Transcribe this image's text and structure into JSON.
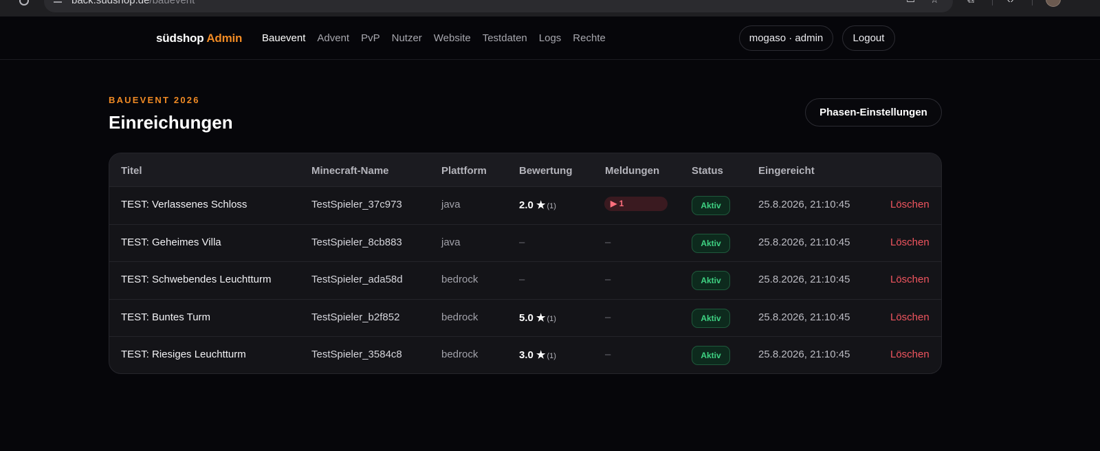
{
  "browser": {
    "url_host": "back.südshop.de",
    "url_path": "/bauevent"
  },
  "brand": {
    "name": "südshop",
    "suffix": "Admin"
  },
  "nav": {
    "items": [
      "Bauevent",
      "Advent",
      "PvP",
      "Nutzer",
      "Website",
      "Testdaten",
      "Logs",
      "Rechte"
    ],
    "active": "Bauevent"
  },
  "user": {
    "label": "mogaso · admin",
    "logout_label": "Logout"
  },
  "page": {
    "eyebrow": "BAUEVENT 2026",
    "title": "Einreichungen",
    "phase_button_label": "Phasen-Einstellungen"
  },
  "table": {
    "columns": [
      "Titel",
      "Minecraft-Name",
      "Plattform",
      "Bewertung",
      "Meldungen",
      "Status",
      "Eingereicht"
    ],
    "rows": [
      {
        "title": "TEST: Verlassenes Schloss",
        "mc_name": "TestSpieler_37c973",
        "platform": "java",
        "rating": "2.0 ★",
        "rating_count": "(1)",
        "reports": "1",
        "status": "Aktiv",
        "submitted": "25.8.2026, 21:10:45",
        "action": "Löschen"
      },
      {
        "title": "TEST: Geheimes Villa",
        "mc_name": "TestSpieler_8cb883",
        "platform": "java",
        "rating": "–",
        "rating_count": "",
        "reports": "–",
        "status": "Aktiv",
        "submitted": "25.8.2026, 21:10:45",
        "action": "Löschen"
      },
      {
        "title": "TEST: Schwebendes Leuchtturm",
        "mc_name": "TestSpieler_ada58d",
        "platform": "bedrock",
        "rating": "–",
        "rating_count": "",
        "reports": "–",
        "status": "Aktiv",
        "submitted": "25.8.2026, 21:10:45",
        "action": "Löschen"
      },
      {
        "title": "TEST: Buntes Turm",
        "mc_name": "TestSpieler_b2f852",
        "platform": "bedrock",
        "rating": "5.0 ★",
        "rating_count": "(1)",
        "reports": "–",
        "status": "Aktiv",
        "submitted": "25.8.2026, 21:10:45",
        "action": "Löschen"
      },
      {
        "title": "TEST: Riesiges Leuchtturm",
        "mc_name": "TestSpieler_3584c8",
        "platform": "bedrock",
        "rating": "3.0 ★",
        "rating_count": "(1)",
        "reports": "–",
        "status": "Aktiv",
        "submitted": "25.8.2026, 21:10:45",
        "action": "Löschen"
      }
    ]
  },
  "colors": {
    "accent": "#f08a24",
    "background": "#06060a",
    "status_active": "#3fd383",
    "danger": "#f0555f"
  }
}
